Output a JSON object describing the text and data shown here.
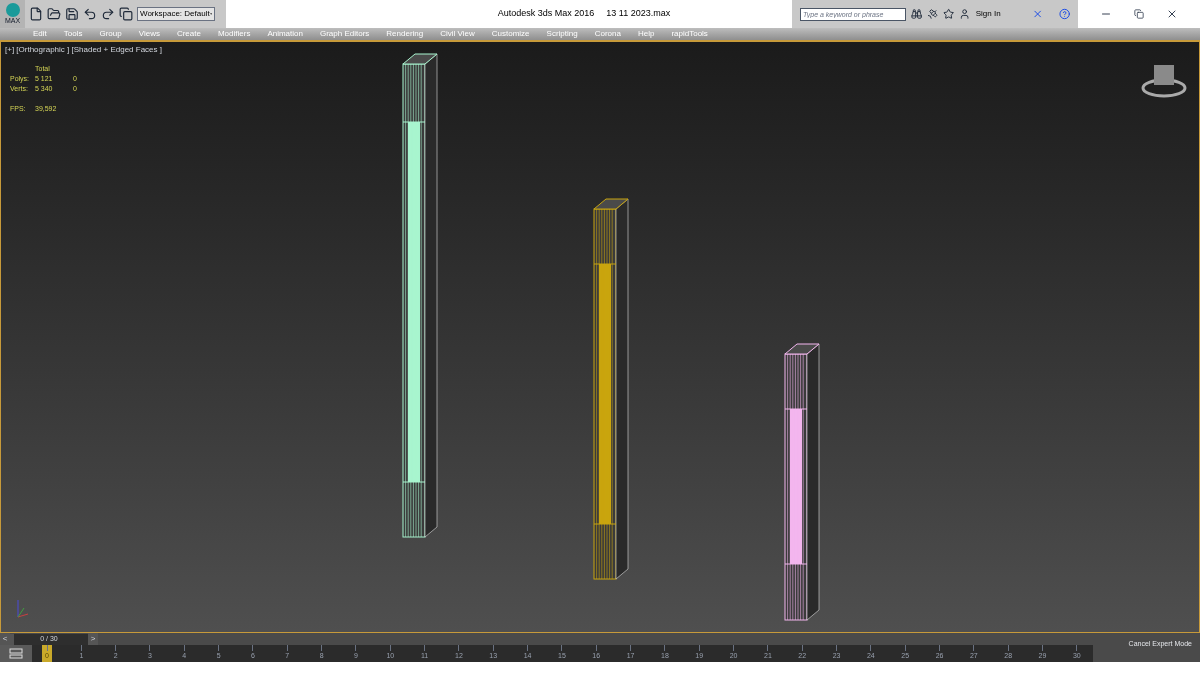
{
  "title_bar": {
    "logo_text": "MAX",
    "workspace": "Workspace: Default",
    "app_title": "Autodesk 3ds Max 2016",
    "file_name": "13 11 2023.max",
    "search": {
      "placeholder": "Type a keyword or phrase"
    },
    "sign_in": "Sign In"
  },
  "menu": [
    "Edit",
    "Tools",
    "Group",
    "Views",
    "Create",
    "Modifiers",
    "Animation",
    "Graph Editors",
    "Rendering",
    "Civil View",
    "Customize",
    "Scripting",
    "Corona",
    "Help",
    "rapidTools"
  ],
  "viewport": {
    "label": "[+] [Orthographic ] [Shaded + Edged Faces ]",
    "stats": {
      "header": "Total",
      "rows": [
        {
          "label": "Polys:",
          "total": "5 121",
          "selection": "0"
        },
        {
          "label": "Verts:",
          "total": "5 340",
          "selection": "0"
        }
      ],
      "fps_label": "FPS:",
      "fps": "39,592"
    },
    "objects": [
      {
        "color": "#a8f5cf"
      },
      {
        "color": "#c9a50e"
      },
      {
        "color": "#f3b6ee"
      }
    ]
  },
  "time_slider": {
    "prev": "<",
    "label": "0 / 30",
    "next": ">",
    "level": 0
  },
  "track_bar": {
    "frames": [
      {
        "label": "0",
        "selected": true
      },
      {
        "label": "1",
        "selected": false
      },
      {
        "label": "2",
        "selected": false
      },
      {
        "label": "3",
        "selected": false
      },
      {
        "label": "4",
        "selected": false
      },
      {
        "label": "5",
        "selected": false
      },
      {
        "label": "6",
        "selected": false
      },
      {
        "label": "7",
        "selected": false
      },
      {
        "label": "8",
        "selected": false
      },
      {
        "label": "9",
        "selected": false
      },
      {
        "label": "10",
        "selected": false
      },
      {
        "label": "11",
        "selected": false
      },
      {
        "label": "12",
        "selected": false
      },
      {
        "label": "13",
        "selected": false
      },
      {
        "label": "14",
        "selected": false
      },
      {
        "label": "15",
        "selected": false
      },
      {
        "label": "16",
        "selected": false
      },
      {
        "label": "17",
        "selected": false
      },
      {
        "label": "18",
        "selected": false
      },
      {
        "label": "19",
        "selected": false
      },
      {
        "label": "20",
        "selected": false
      },
      {
        "label": "21",
        "selected": false
      },
      {
        "label": "22",
        "selected": false
      },
      {
        "label": "23",
        "selected": false
      },
      {
        "label": "24",
        "selected": false
      },
      {
        "label": "25",
        "selected": false
      },
      {
        "label": "26",
        "selected": false
      },
      {
        "label": "27",
        "selected": false
      },
      {
        "label": "28",
        "selected": false
      },
      {
        "label": "29",
        "selected": false
      },
      {
        "label": "30",
        "selected": false
      }
    ],
    "cancel_expert": "Cancel Expert Mode"
  }
}
